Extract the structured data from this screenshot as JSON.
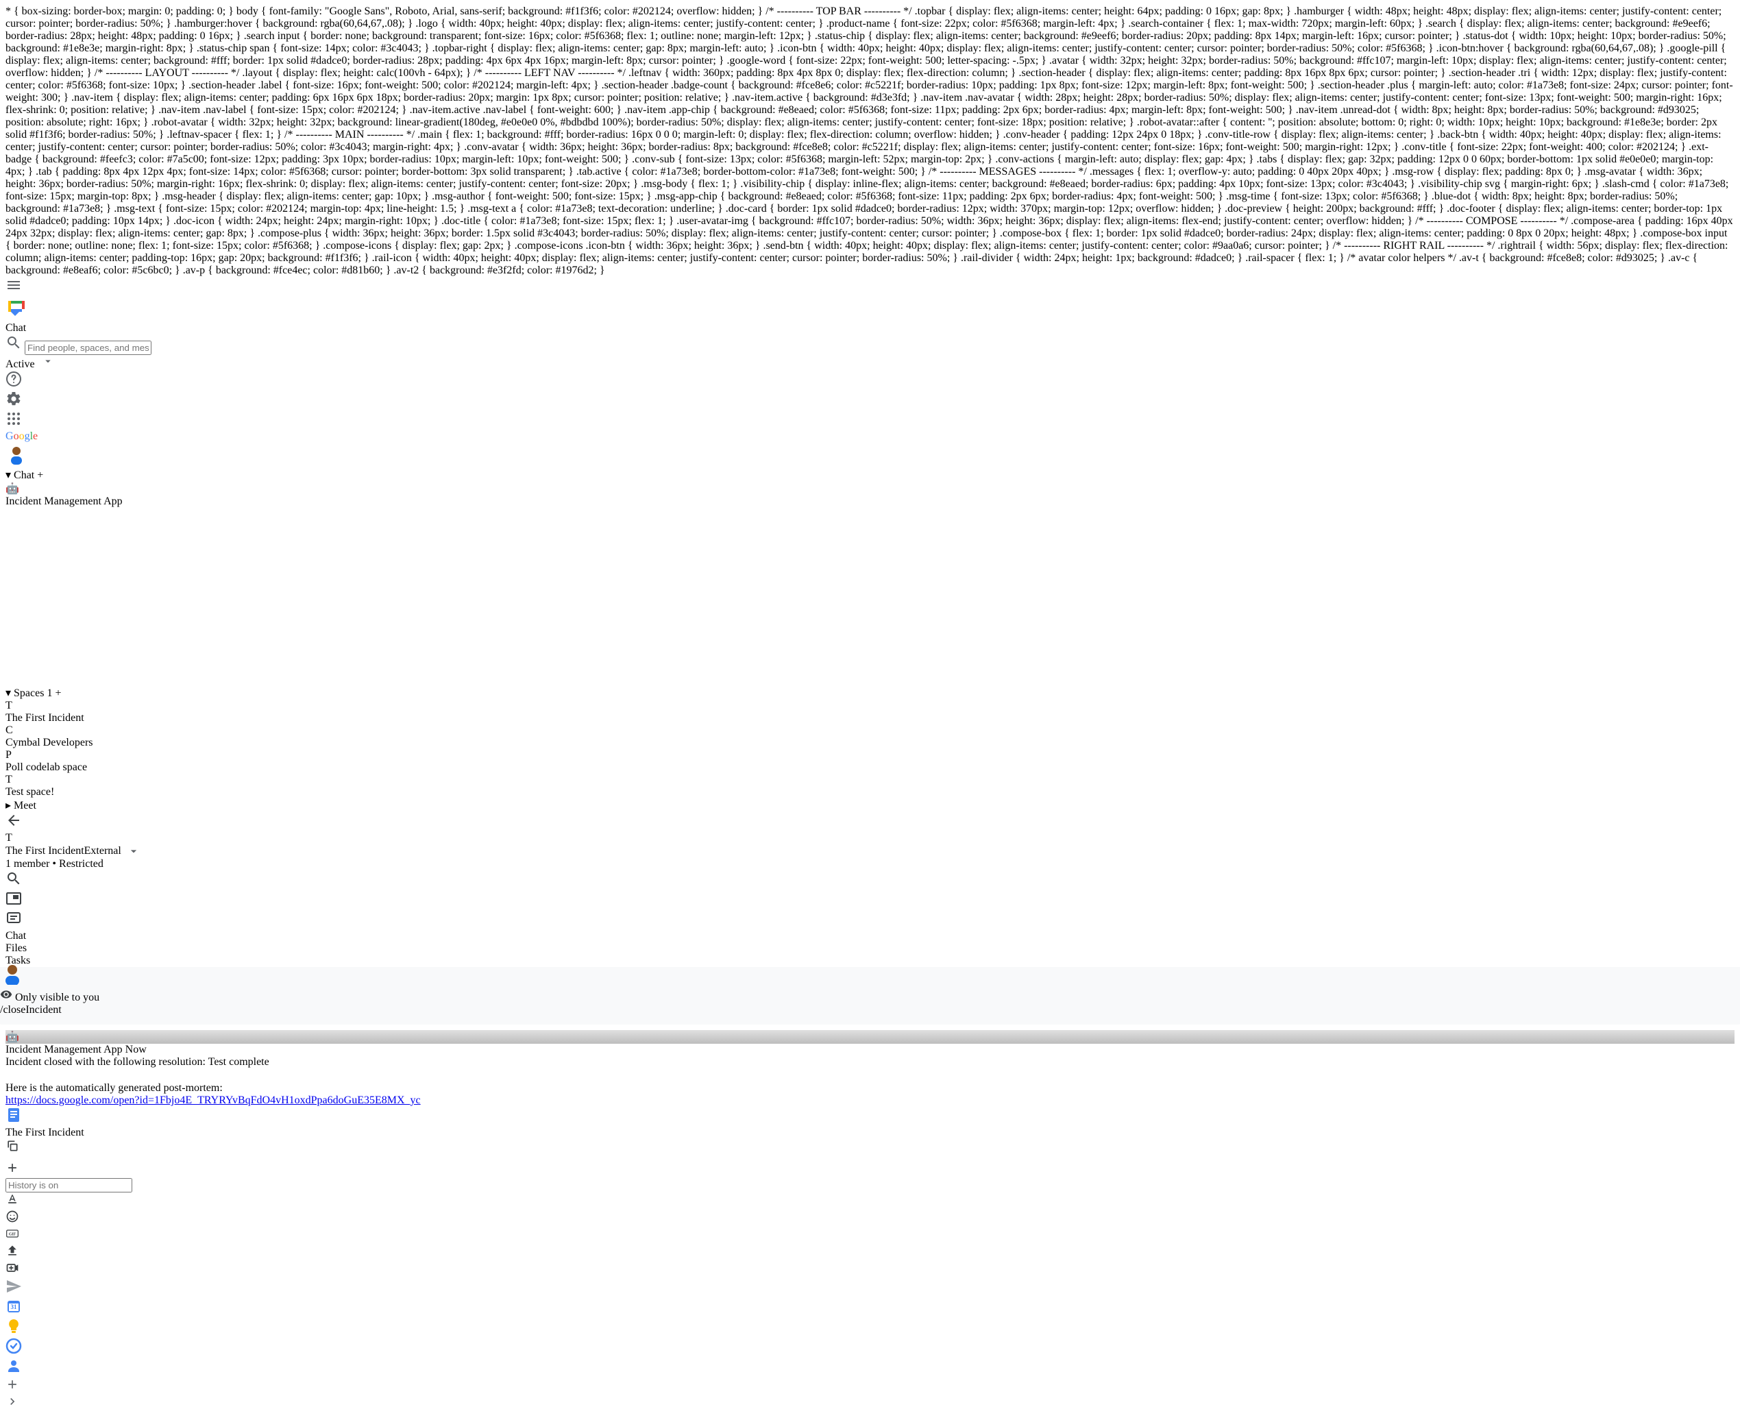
{
  "topbar": {
    "product": "Chat",
    "search_placeholder": "Find people, spaces, and messages",
    "status": "Active",
    "google_word": "Google"
  },
  "leftnav": {
    "sections": {
      "chat": {
        "label": "Chat"
      },
      "spaces": {
        "label": "Spaces",
        "badge": "1"
      },
      "meet": {
        "label": "Meet"
      }
    },
    "chat_items": [
      {
        "label": "Incident Management",
        "chip": "App"
      }
    ],
    "space_items": [
      {
        "letter": "T",
        "label": "The First Incident",
        "active": true,
        "unread": true,
        "av_class": "av-t"
      },
      {
        "letter": "C",
        "label": "Cymbal Developers",
        "av_class": "av-c"
      },
      {
        "letter": "P",
        "label": "Poll codelab space",
        "av_class": "av-p"
      },
      {
        "letter": "T",
        "label": "Test space!",
        "av_class": "av-t2"
      }
    ]
  },
  "conversation": {
    "avatar_letter": "T",
    "title": "The First Incident",
    "external_badge": "External",
    "subtitle": "1 member  •  Restricted",
    "tabs": {
      "chat": "Chat",
      "files": "Files",
      "tasks": "Tasks"
    }
  },
  "messages": {
    "visibility_text": "Only visible to you",
    "slash_command": "/closeIncident",
    "bot": {
      "name": "Incident Management",
      "chip": "App",
      "time": "Now",
      "line1": "Incident closed with the following resolution: Test complete",
      "line2": "Here is the automatically generated post-mortem:",
      "link": "https://docs.google.com/open?id=1Fbjo4E_TRYRYvBqFdO4vH1oxdPpa6doGuE35E8MX_yc",
      "doc_title": "The First Incident"
    }
  },
  "compose": {
    "placeholder": "History is on"
  },
  "rail": {
    "calendar_day": "31"
  }
}
